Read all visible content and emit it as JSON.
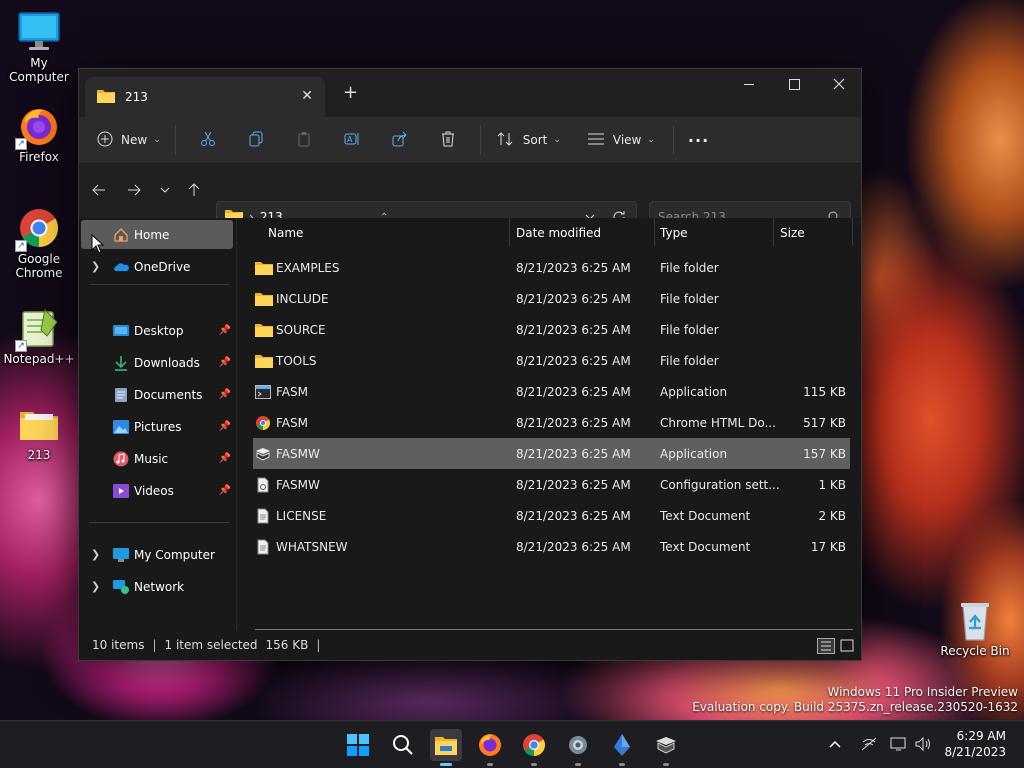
{
  "desktop": {
    "icons": [
      {
        "label": "My Computer",
        "icon": "monitor-icon"
      },
      {
        "label": "Firefox",
        "icon": "firefox-icon"
      },
      {
        "label": "Google Chrome",
        "icon": "chrome-icon"
      },
      {
        "label": "Notepad++",
        "icon": "notepadpp-icon"
      },
      {
        "label": "213",
        "icon": "folder-icon"
      },
      {
        "label": "Recycle Bin",
        "icon": "recycle-bin-icon"
      }
    ],
    "watermark": {
      "line1": "Windows 11 Pro Insider Preview",
      "line2": "Evaluation copy. Build 25375.zn_release.230520-1632"
    }
  },
  "window": {
    "tab_title": "213",
    "toolbar": {
      "new_label": "New",
      "sort_label": "Sort",
      "view_label": "View",
      "more_label": "···"
    },
    "address": {
      "separator": "›",
      "path": "213"
    },
    "search": {
      "placeholder": "Search 213"
    },
    "nav": {
      "home": "Home",
      "onedrive": "OneDrive",
      "desktop": "Desktop",
      "downloads": "Downloads",
      "documents": "Documents",
      "pictures": "Pictures",
      "music": "Music",
      "videos": "Videos",
      "my_computer": "My Computer",
      "network": "Network"
    },
    "columns": {
      "name": "Name",
      "date": "Date modified",
      "type": "Type",
      "size": "Size"
    },
    "files": [
      {
        "name": "EXAMPLES",
        "date": "8/21/2023 6:25 AM",
        "type": "File folder",
        "size": "",
        "icon": "folder-icon"
      },
      {
        "name": "INCLUDE",
        "date": "8/21/2023 6:25 AM",
        "type": "File folder",
        "size": "",
        "icon": "folder-icon"
      },
      {
        "name": "SOURCE",
        "date": "8/21/2023 6:25 AM",
        "type": "File folder",
        "size": "",
        "icon": "folder-icon"
      },
      {
        "name": "TOOLS",
        "date": "8/21/2023 6:25 AM",
        "type": "File folder",
        "size": "",
        "icon": "folder-icon"
      },
      {
        "name": "FASM",
        "date": "8/21/2023 6:25 AM",
        "type": "Application",
        "size": "115 KB",
        "icon": "console-app-icon"
      },
      {
        "name": "FASM",
        "date": "8/21/2023 6:25 AM",
        "type": "Chrome HTML Do...",
        "size": "517 KB",
        "icon": "chrome-html-icon"
      },
      {
        "name": "FASMW",
        "date": "8/21/2023 6:25 AM",
        "type": "Application",
        "size": "157 KB",
        "icon": "fasmw-app-icon"
      },
      {
        "name": "FASMW",
        "date": "8/21/2023 6:25 AM",
        "type": "Configuration sett...",
        "size": "1 KB",
        "icon": "config-file-icon"
      },
      {
        "name": "LICENSE",
        "date": "8/21/2023 6:25 AM",
        "type": "Text Document",
        "size": "2 KB",
        "icon": "text-file-icon"
      },
      {
        "name": "WHATSNEW",
        "date": "8/21/2023 6:25 AM",
        "type": "Text Document",
        "size": "17 KB",
        "icon": "text-file-icon"
      }
    ],
    "selected_row_index": 6,
    "status": {
      "items": "10 items",
      "selected": "1 item selected",
      "size": "156 KB"
    }
  },
  "taskbar": {
    "time": "6:29 AM",
    "date": "8/21/2023"
  }
}
